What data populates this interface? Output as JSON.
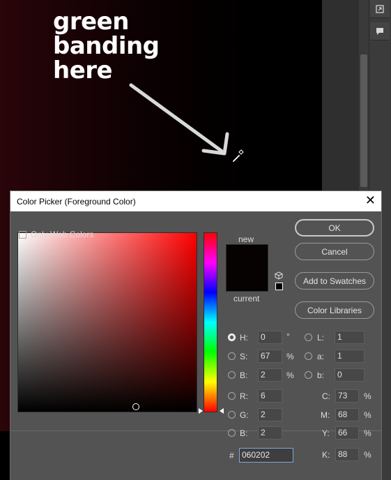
{
  "annotation": {
    "line1": "green",
    "line2": "banding",
    "line3": "here"
  },
  "dialog": {
    "title": "Color Picker (Foreground Color)",
    "close": "✕",
    "new_label": "new",
    "current_label": "current",
    "new_color": "#060202",
    "current_color": "#060202",
    "buttons": {
      "ok": "OK",
      "cancel": "Cancel",
      "add_swatches": "Add to Swatches",
      "color_libraries": "Color Libraries"
    },
    "only_web_colors": "Only Web Colors",
    "hsb": {
      "h": {
        "label": "H:",
        "value": "0",
        "unit": "°"
      },
      "s": {
        "label": "S:",
        "value": "67",
        "unit": "%"
      },
      "b": {
        "label": "B:",
        "value": "2",
        "unit": "%"
      }
    },
    "rgb": {
      "r": {
        "label": "R:",
        "value": "6"
      },
      "g": {
        "label": "G:",
        "value": "2"
      },
      "b": {
        "label": "B:",
        "value": "2"
      }
    },
    "lab": {
      "l": {
        "label": "L:",
        "value": "1"
      },
      "a": {
        "label": "a:",
        "value": "1"
      },
      "b": {
        "label": "b:",
        "value": "0"
      }
    },
    "cmyk": {
      "c": {
        "label": "C:",
        "value": "73",
        "unit": "%"
      },
      "m": {
        "label": "M:",
        "value": "68",
        "unit": "%"
      },
      "y": {
        "label": "Y:",
        "value": "66",
        "unit": "%"
      },
      "k": {
        "label": "K:",
        "value": "88",
        "unit": "%"
      }
    },
    "hex": {
      "label": "#",
      "value": "060202"
    }
  },
  "icons": {
    "right_panel_1": "expand-icon",
    "right_panel_2": "comment-icon",
    "cursor": "eyedropper-icon",
    "arrow": "arrow-icon"
  }
}
